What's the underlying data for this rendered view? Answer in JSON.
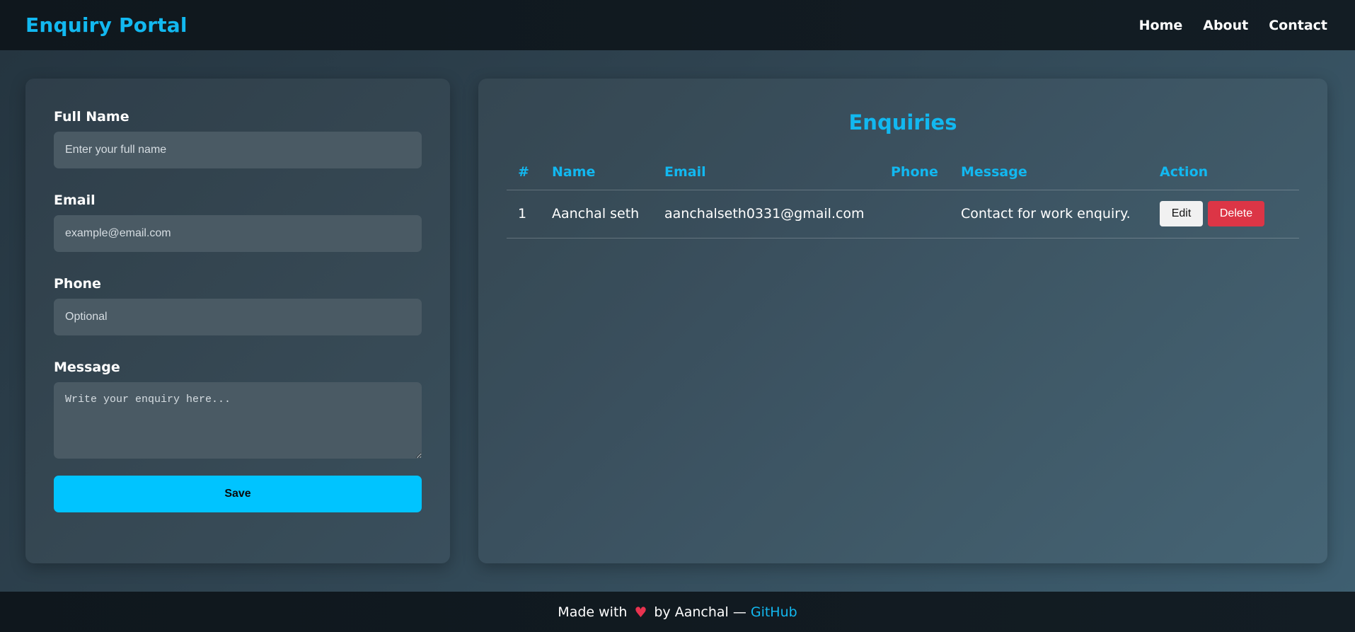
{
  "header": {
    "brand": "Enquiry Portal",
    "nav": [
      "Home",
      "About",
      "Contact"
    ]
  },
  "form": {
    "name_label": "Full Name",
    "name_placeholder": "Enter your full name",
    "email_label": "Email",
    "email_placeholder": "example@email.com",
    "phone_label": "Phone",
    "phone_placeholder": "Optional",
    "message_label": "Message",
    "message_placeholder": "Write your enquiry here...",
    "save_label": "Save"
  },
  "table": {
    "title": "Enquiries",
    "columns": [
      "#",
      "Name",
      "Email",
      "Phone",
      "Message",
      "Action"
    ],
    "rows": [
      {
        "num": "1",
        "name": "Aanchal seth",
        "email": "aanchalseth0331@gmail.com",
        "phone": "",
        "message": "Contact for work enquiry.",
        "edit_label": "Edit",
        "delete_label": "Delete"
      }
    ]
  },
  "footer": {
    "prefix": "Made with",
    "heart": "♥",
    "middle": "by Aanchal —",
    "link": "GitHub"
  },
  "colors": {
    "accent": "#12b8f0",
    "save_button": "#00c4ff",
    "delete_button": "#dc3546",
    "heart": "#e8334f"
  },
  "icons": {
    "footer_heart": "heart-icon"
  }
}
